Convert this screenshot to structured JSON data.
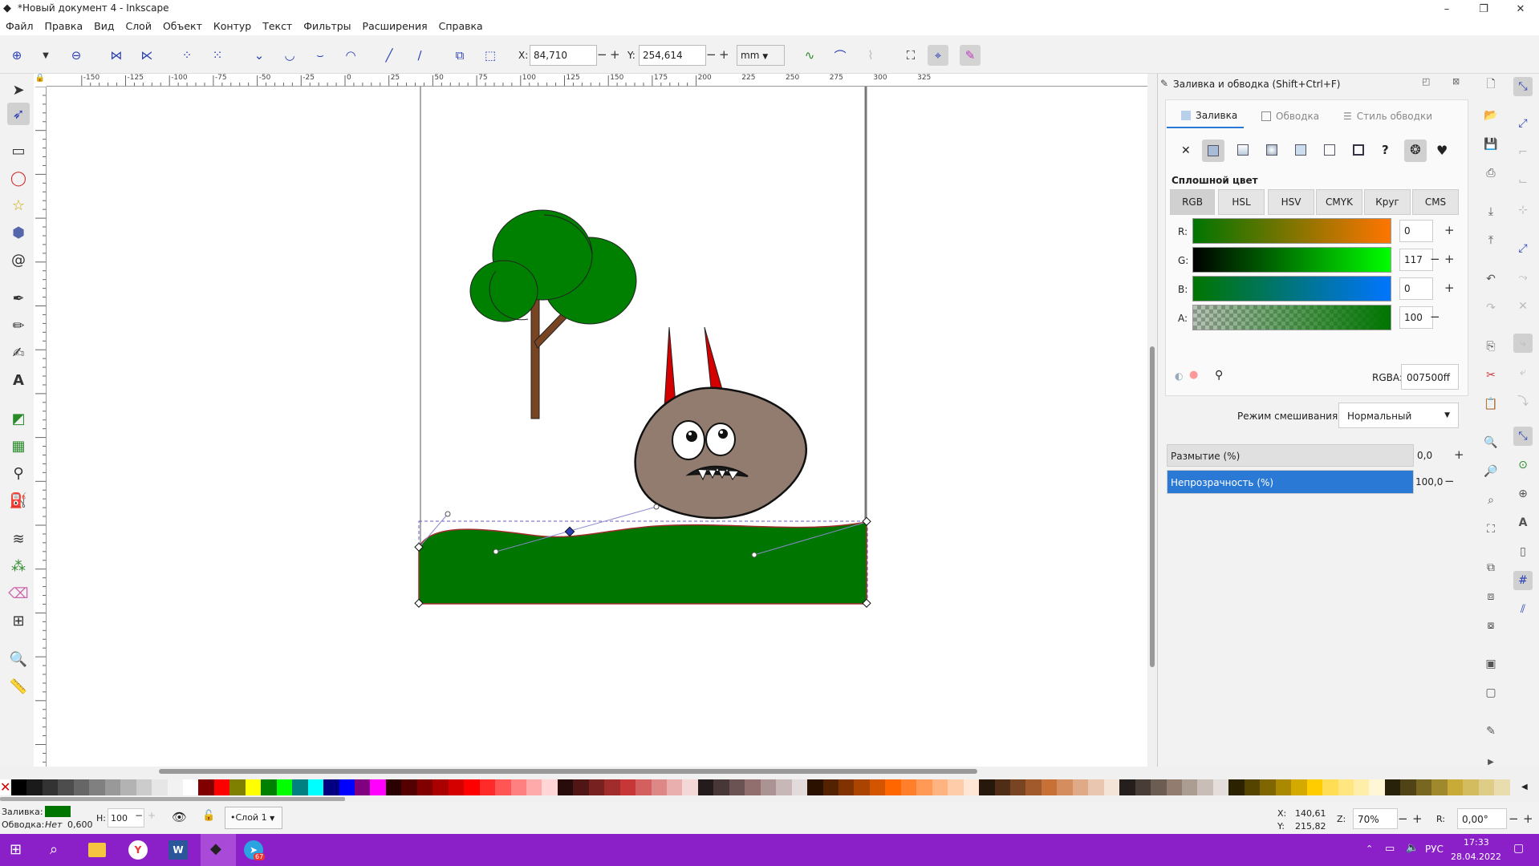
{
  "window": {
    "title": "*Новый документ 4 - Inkscape",
    "minimize": "–",
    "maximize": "❐",
    "close": "✕"
  },
  "menu": [
    "Файл",
    "Правка",
    "Вид",
    "Слой",
    "Объект",
    "Контур",
    "Текст",
    "Фильтры",
    "Расширения",
    "Справка"
  ],
  "toolctrl": {
    "x_label": "X:",
    "x_value": "84,710",
    "y_label": "Y:",
    "y_value": "254,614",
    "unit": "mm"
  },
  "ruler": {
    "ticks": [
      "-150",
      "-125",
      "-100",
      "-75",
      "-50",
      "-25",
      "0",
      "25",
      "50",
      "75",
      "100",
      "125",
      "150",
      "175",
      "200",
      "225",
      "250",
      "275",
      "300",
      "325"
    ]
  },
  "panel": {
    "title": "Заливка и обводка (Shift+Ctrl+F)",
    "tabs": [
      "Заливка",
      "Обводка",
      "Стиль обводки"
    ],
    "fill_type": "Сплошной цвет",
    "color_modes": [
      "RGB",
      "HSL",
      "HSV",
      "CMYK",
      "Круг",
      "CMS"
    ],
    "channels": [
      {
        "label": "R:",
        "value": "0"
      },
      {
        "label": "G:",
        "value": "117"
      },
      {
        "label": "B:",
        "value": "0"
      },
      {
        "label": "A:",
        "value": "100"
      }
    ],
    "rgba_label": "RGBA:",
    "rgba_value": "007500ff",
    "blend_label": "Режим смешивания:",
    "blend_value": "Нормальный",
    "blur_label": "Размытие (%)",
    "blur_value": "0,0",
    "opacity_label": "Непрозрачность (%)",
    "opacity_value": "100,0",
    "opacity_level": 1.0
  },
  "status": {
    "fill_label": "Заливка:",
    "stroke_label": "Обводка:",
    "stroke_value": "Нет",
    "stroke_width": "0,600",
    "h_label": "Н:",
    "h_value": "100",
    "layer": "•Слой 1",
    "cx_label": "X:",
    "cx_value": "140,61",
    "cy_label": "Y:",
    "cy_value": "215,82",
    "zoom_label": "Z:",
    "zoom_value": "70%",
    "rot_label": "R:",
    "rot_value": "0,00°"
  },
  "taskbar": {
    "lang": "РУС",
    "time": "17:33",
    "date": "28.04.2022",
    "tg_badge": "67"
  },
  "colors": {
    "fill": "#007500",
    "accent": "#2a7ad5",
    "taskbar": "#8b20c8"
  },
  "palette": [
    "#000000",
    "#1a1a1a",
    "#333333",
    "#4d4d4d",
    "#666666",
    "#808080",
    "#999999",
    "#b3b3b3",
    "#cccccc",
    "#e6e6e6",
    "#f2f2f2",
    "#ffffff",
    "#800000",
    "#ff0000",
    "#808000",
    "#ffff00",
    "#008000",
    "#00ff00",
    "#008080",
    "#00ffff",
    "#000080",
    "#0000ff",
    "#800080",
    "#ff00ff",
    "#2b0000",
    "#550000",
    "#800000",
    "#aa0000",
    "#d40000",
    "#ff0000",
    "#ff2a2a",
    "#ff5555",
    "#ff8080",
    "#ffaaaa",
    "#ffd5d5",
    "#280b0b",
    "#501616",
    "#782121",
    "#a02c2c",
    "#c83737",
    "#d35f5f",
    "#de8787",
    "#e9afaf",
    "#f4d7d7",
    "#241c1c",
    "#483737",
    "#6c5353",
    "#916f6f",
    "#ac9393",
    "#c8b7b7",
    "#e3dbdb",
    "#2b1100",
    "#552200",
    "#803300",
    "#aa4400",
    "#d45500",
    "#ff6600",
    "#ff7f2a",
    "#ff9955",
    "#ffb380",
    "#ffccaa",
    "#ffe6d5",
    "#28170b",
    "#502d16",
    "#784421",
    "#a05a2c",
    "#c87137",
    "#d38d5f",
    "#deaa87",
    "#e9c6af",
    "#f4e3d7",
    "#241f1c",
    "#483e37",
    "#6c5d53",
    "#917c6f",
    "#ac9d93",
    "#c8beb7",
    "#e3dedb",
    "#2b2200",
    "#554400",
    "#806600",
    "#aa8800",
    "#d4aa00",
    "#ffcc00",
    "#ffdd55",
    "#ffe680",
    "#ffeeaa",
    "#fff6d5",
    "#28220b",
    "#504416",
    "#786721",
    "#a0892c",
    "#c8ab37",
    "#d3bc5f",
    "#decd87",
    "#e9ddaf"
  ]
}
